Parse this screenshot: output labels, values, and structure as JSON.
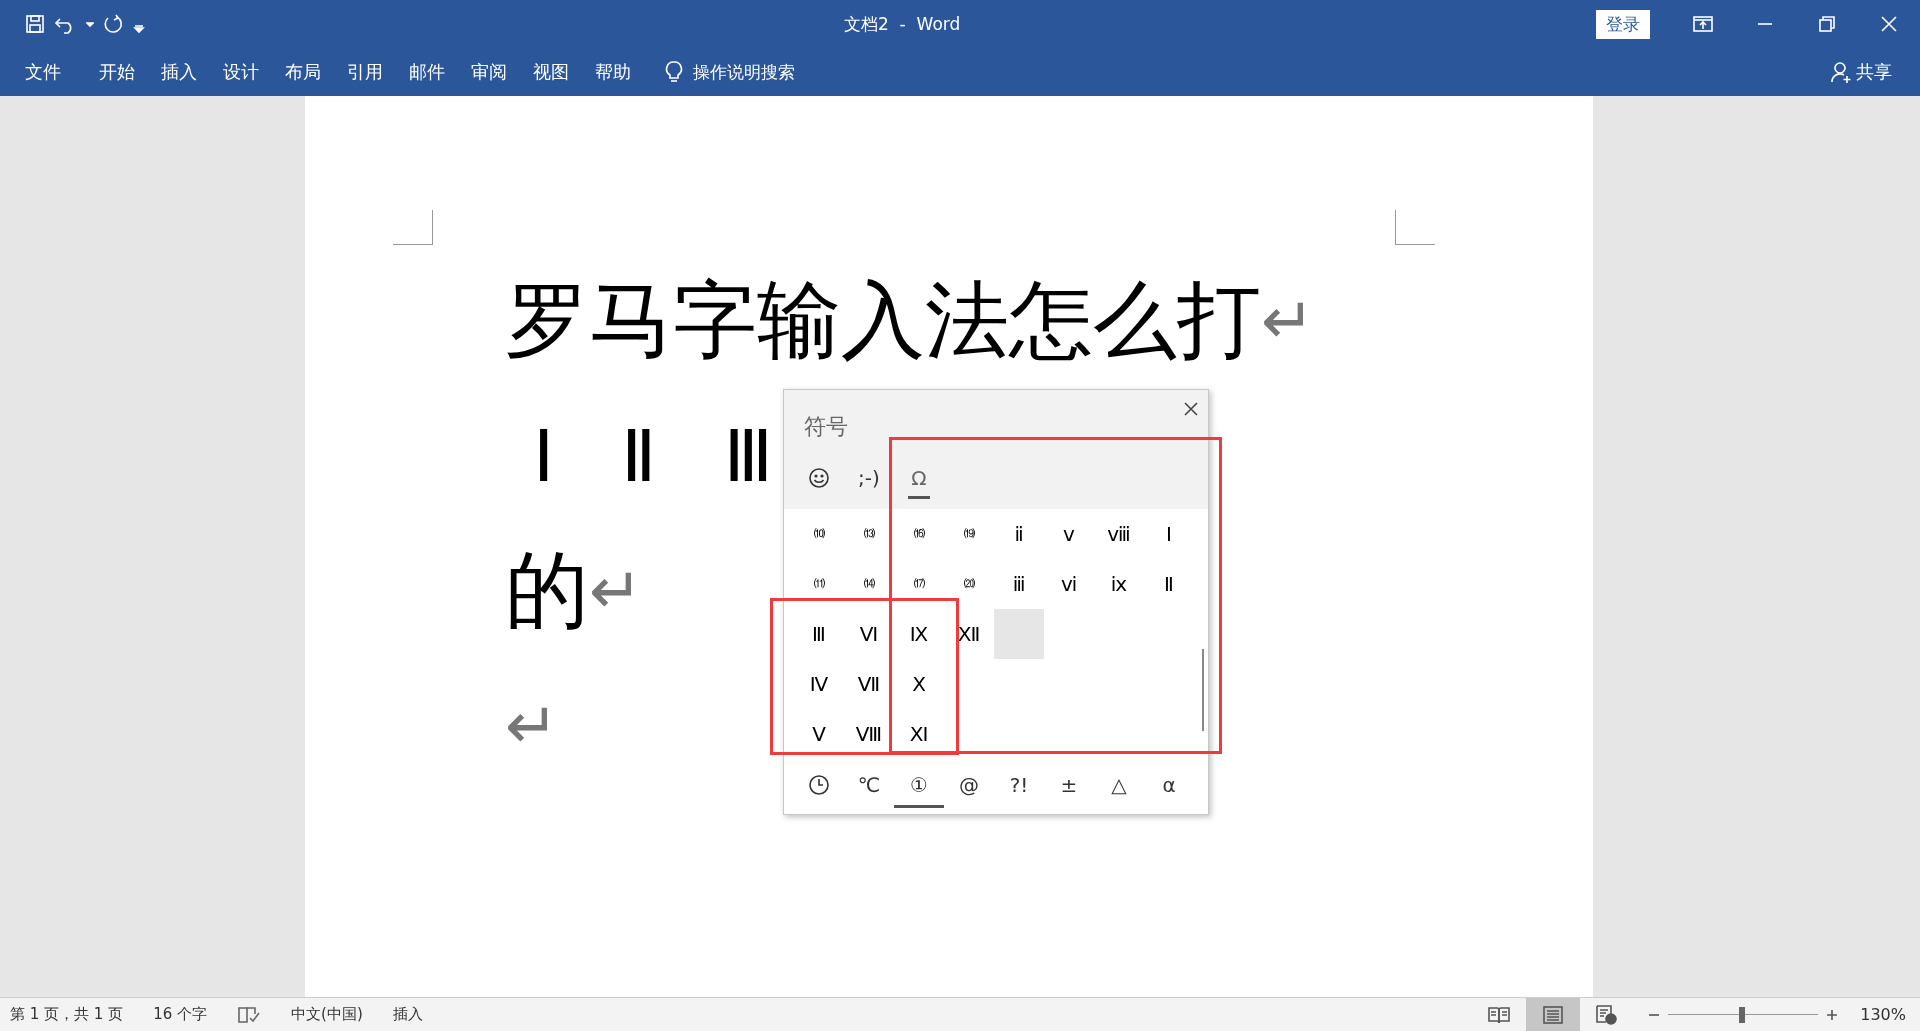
{
  "window": {
    "title": "文档2  -  Word",
    "sign_in": "登录"
  },
  "ribbon_tabs": [
    {
      "label": "文件"
    },
    {
      "label": "开始"
    },
    {
      "label": "插入"
    },
    {
      "label": "设计"
    },
    {
      "label": "布局"
    },
    {
      "label": "引用"
    },
    {
      "label": "邮件"
    },
    {
      "label": "审阅"
    },
    {
      "label": "视图"
    },
    {
      "label": "帮助"
    }
  ],
  "tell_me": {
    "placeholder": "操作说明搜索"
  },
  "share": "共享",
  "document": {
    "lines": [
      {
        "text": "罗马字输入法怎么打",
        "mark": "↵"
      },
      {
        "text": "Ⅰ Ⅱ Ⅲ"
      },
      {
        "text": "的",
        "mark": "↵"
      },
      {
        "mark": "↵"
      }
    ]
  },
  "symbol_panel": {
    "title": "符号",
    "tabs": [
      {
        "kind": "face",
        "selected": false
      },
      {
        "kind": "text",
        "label": ";-)",
        "selected": false
      },
      {
        "kind": "text",
        "label": "Ω",
        "selected": true
      }
    ],
    "rows": [
      [
        {
          "symbol": "⑽",
          "selected": false
        },
        {
          "symbol": "⒀",
          "selected": false
        },
        {
          "symbol": "⒃",
          "selected": false
        },
        {
          "symbol": "⒆",
          "selected": false
        },
        {
          "symbol": "ⅱ",
          "selected": false
        },
        {
          "symbol": "ⅴ",
          "selected": false
        },
        {
          "symbol": "ⅷ",
          "selected": false
        },
        {
          "symbol": "Ⅰ",
          "selected": false
        }
      ],
      [
        {
          "symbol": "⑾",
          "selected": false
        },
        {
          "symbol": "⒁",
          "selected": false
        },
        {
          "symbol": "⒄",
          "selected": false
        },
        {
          "symbol": "⒇",
          "selected": false
        },
        {
          "symbol": "ⅲ",
          "selected": false
        },
        {
          "symbol": "ⅵ",
          "selected": false
        },
        {
          "symbol": "ⅸ",
          "selected": false
        },
        {
          "symbol": "Ⅱ",
          "selected": false
        }
      ],
      [
        {
          "symbol": "Ⅲ",
          "selected": false
        },
        {
          "symbol": "Ⅵ",
          "selected": false
        },
        {
          "symbol": "Ⅸ",
          "selected": false
        },
        {
          "symbol": "Ⅻ",
          "selected": false
        },
        {
          "selected": true
        }
      ],
      [
        {
          "symbol": "Ⅳ",
          "selected": false
        },
        {
          "symbol": "Ⅶ",
          "selected": false
        },
        {
          "symbol": "Ⅹ",
          "selected": false
        }
      ],
      [
        {
          "symbol": "Ⅴ",
          "selected": false
        },
        {
          "symbol": "Ⅷ",
          "selected": false
        },
        {
          "symbol": "Ⅺ",
          "selected": false
        }
      ]
    ],
    "categories": [
      {
        "kind": "clock",
        "selected": false
      },
      {
        "kind": "text",
        "label": "℃",
        "selected": false
      },
      {
        "kind": "text",
        "label": "①",
        "selected": true
      },
      {
        "kind": "text",
        "label": "@",
        "selected": false
      },
      {
        "kind": "text",
        "label": "?!",
        "selected": false
      },
      {
        "kind": "text",
        "label": "±",
        "selected": false
      },
      {
        "kind": "text",
        "label": "△",
        "selected": false
      },
      {
        "kind": "text",
        "label": "α",
        "selected": false
      }
    ]
  },
  "status_bar": {
    "page": "第 1 页，共 1 页",
    "words": "16 个字",
    "language": "中文(中国)",
    "mode": "插入",
    "views": [
      {
        "kind": "read",
        "selected": false
      },
      {
        "kind": "print",
        "selected": true
      },
      {
        "kind": "web",
        "selected": false
      }
    ],
    "zoom": {
      "level": 0.49,
      "reading": "130%"
    }
  }
}
